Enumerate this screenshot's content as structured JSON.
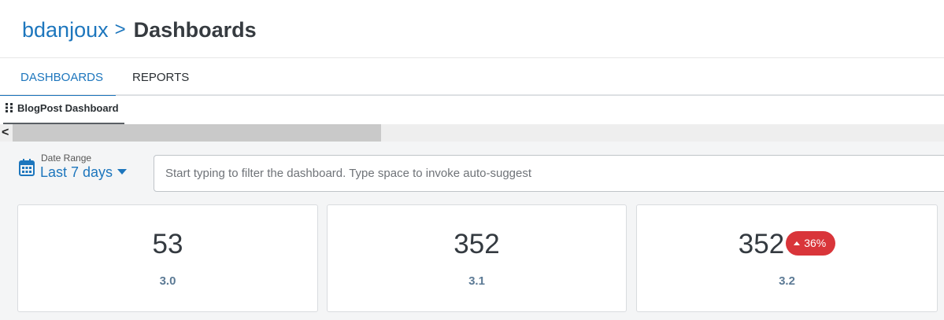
{
  "breadcrumb": {
    "parent": "bdanjoux",
    "separator": ">",
    "current": "Dashboards"
  },
  "tabs": [
    {
      "label": "DASHBOARDS",
      "active": true
    },
    {
      "label": "REPORTS",
      "active": false
    }
  ],
  "subtab": {
    "label": "BlogPost Dashboard",
    "icon": "grid-icon"
  },
  "scroll": {
    "left_arrow": "<"
  },
  "date_range": {
    "label": "Date Range",
    "value": "Last 7 days",
    "icon": "calendar-icon"
  },
  "filter": {
    "value": "",
    "placeholder": "Start typing to filter the dashboard. Type space to invoke auto-suggest"
  },
  "cards": [
    {
      "value": "53",
      "subtitle": "3.0"
    },
    {
      "value": "352",
      "subtitle": "3.1"
    },
    {
      "value": "352",
      "subtitle": "3.2",
      "delta": "36%",
      "delta_direction": "up"
    }
  ],
  "colors": {
    "accent": "#1d76bd",
    "badge_negative": "#d9353a",
    "subtitle": "#5c7a95"
  }
}
